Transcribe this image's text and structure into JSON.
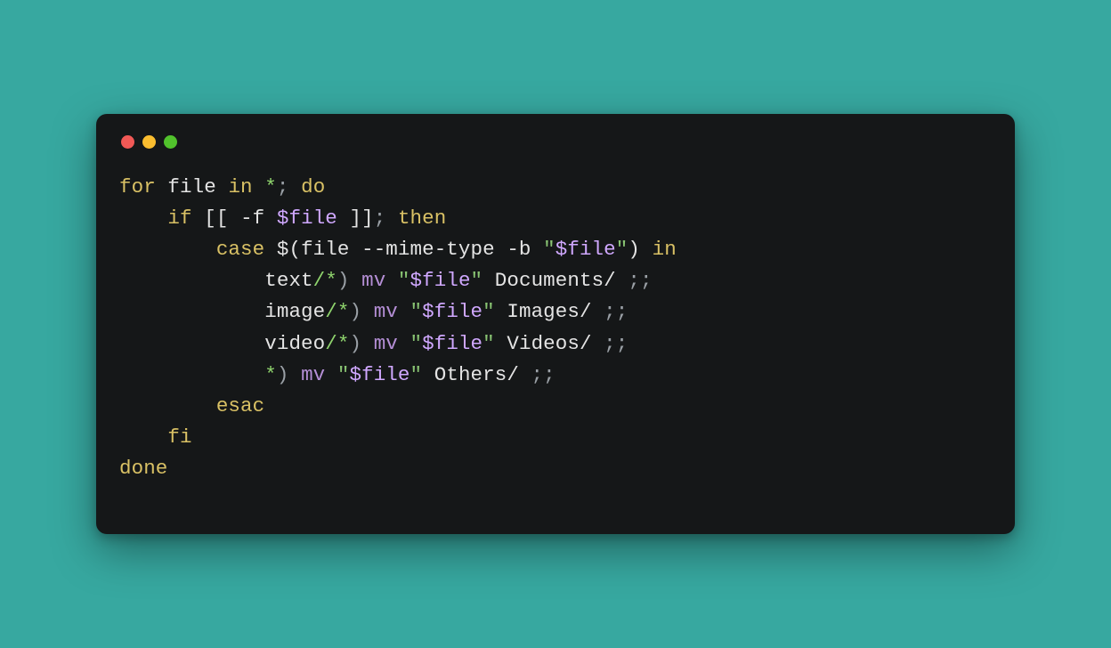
{
  "window": {
    "dot_colors": {
      "red": "#f15956",
      "yellow": "#fabd2f",
      "green": "#51c22c"
    }
  },
  "code": {
    "language": "bash",
    "lines": [
      {
        "indent": 0,
        "tokens": [
          {
            "t": "for",
            "c": "kw"
          },
          {
            "t": " ",
            "c": "sp"
          },
          {
            "t": "file",
            "c": "var"
          },
          {
            "t": " ",
            "c": "sp"
          },
          {
            "t": "in",
            "c": "kw"
          },
          {
            "t": " ",
            "c": "sp"
          },
          {
            "t": "*",
            "c": "glob"
          },
          {
            "t": "; ",
            "c": "op"
          },
          {
            "t": "do",
            "c": "kw"
          }
        ]
      },
      {
        "indent": 1,
        "tokens": [
          {
            "t": "if",
            "c": "kw"
          },
          {
            "t": " ",
            "c": "sp"
          },
          {
            "t": "[[ ",
            "c": "test"
          },
          {
            "t": "-f",
            "c": "flag"
          },
          {
            "t": " ",
            "c": "sp"
          },
          {
            "t": "$file",
            "c": "varin"
          },
          {
            "t": " ]]",
            "c": "test"
          },
          {
            "t": "; ",
            "c": "op"
          },
          {
            "t": "then",
            "c": "kw"
          }
        ]
      },
      {
        "indent": 2,
        "tokens": [
          {
            "t": "case",
            "c": "kw"
          },
          {
            "t": " ",
            "c": "sp"
          },
          {
            "t": "$(",
            "c": "subsh"
          },
          {
            "t": "file ",
            "c": "var"
          },
          {
            "t": "--mime-type -b",
            "c": "flag"
          },
          {
            "t": " ",
            "c": "sp"
          },
          {
            "t": "\"",
            "c": "str"
          },
          {
            "t": "$file",
            "c": "varin"
          },
          {
            "t": "\"",
            "c": "str"
          },
          {
            "t": ")",
            "c": "subsh"
          },
          {
            "t": " ",
            "c": "sp"
          },
          {
            "t": "in",
            "c": "kw"
          }
        ]
      },
      {
        "indent": 3,
        "tokens": [
          {
            "t": "text",
            "c": "var"
          },
          {
            "t": "/*",
            "c": "glob"
          },
          {
            "t": ") ",
            "c": "op"
          },
          {
            "t": "mv",
            "c": "cmd"
          },
          {
            "t": " ",
            "c": "sp"
          },
          {
            "t": "\"",
            "c": "str"
          },
          {
            "t": "$file",
            "c": "varin"
          },
          {
            "t": "\"",
            "c": "str"
          },
          {
            "t": " ",
            "c": "sp"
          },
          {
            "t": "Documents/",
            "c": "path"
          },
          {
            "t": " ;;",
            "c": "op"
          }
        ]
      },
      {
        "indent": 3,
        "tokens": [
          {
            "t": "image",
            "c": "var"
          },
          {
            "t": "/*",
            "c": "glob"
          },
          {
            "t": ") ",
            "c": "op"
          },
          {
            "t": "mv",
            "c": "cmd"
          },
          {
            "t": " ",
            "c": "sp"
          },
          {
            "t": "\"",
            "c": "str"
          },
          {
            "t": "$file",
            "c": "varin"
          },
          {
            "t": "\"",
            "c": "str"
          },
          {
            "t": " ",
            "c": "sp"
          },
          {
            "t": "Images/",
            "c": "path"
          },
          {
            "t": " ;;",
            "c": "op"
          }
        ]
      },
      {
        "indent": 3,
        "tokens": [
          {
            "t": "video",
            "c": "var"
          },
          {
            "t": "/*",
            "c": "glob"
          },
          {
            "t": ") ",
            "c": "op"
          },
          {
            "t": "mv",
            "c": "cmd"
          },
          {
            "t": " ",
            "c": "sp"
          },
          {
            "t": "\"",
            "c": "str"
          },
          {
            "t": "$file",
            "c": "varin"
          },
          {
            "t": "\"",
            "c": "str"
          },
          {
            "t": " ",
            "c": "sp"
          },
          {
            "t": "Videos/",
            "c": "path"
          },
          {
            "t": " ;;",
            "c": "op"
          }
        ]
      },
      {
        "indent": 3,
        "tokens": [
          {
            "t": "*",
            "c": "glob"
          },
          {
            "t": ") ",
            "c": "op"
          },
          {
            "t": "mv",
            "c": "cmd"
          },
          {
            "t": " ",
            "c": "sp"
          },
          {
            "t": "\"",
            "c": "str"
          },
          {
            "t": "$file",
            "c": "varin"
          },
          {
            "t": "\"",
            "c": "str"
          },
          {
            "t": " ",
            "c": "sp"
          },
          {
            "t": "Others/",
            "c": "path"
          },
          {
            "t": " ;;",
            "c": "op"
          }
        ]
      },
      {
        "indent": 2,
        "tokens": [
          {
            "t": "esac",
            "c": "kw"
          }
        ]
      },
      {
        "indent": 1,
        "tokens": [
          {
            "t": "fi",
            "c": "kw"
          }
        ]
      },
      {
        "indent": 0,
        "tokens": [
          {
            "t": "done",
            "c": "kw"
          }
        ]
      }
    ]
  }
}
